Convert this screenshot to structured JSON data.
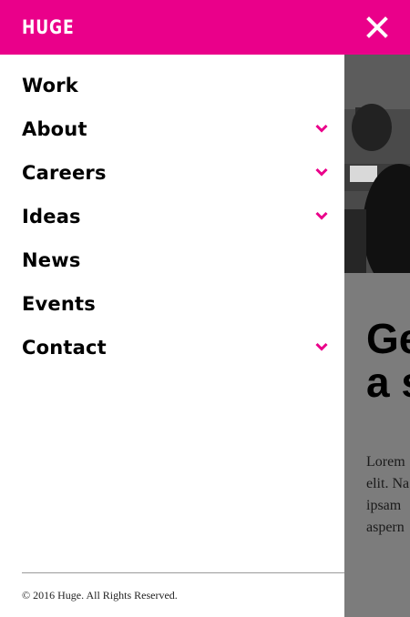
{
  "header": {
    "logo": "HUGE",
    "close_icon": "close-icon",
    "brand_color": "#ea008a"
  },
  "nav": {
    "items": [
      {
        "label": "Work",
        "has_submenu": false
      },
      {
        "label": "About",
        "has_submenu": true
      },
      {
        "label": "Careers",
        "has_submenu": true
      },
      {
        "label": "Ideas",
        "has_submenu": true
      },
      {
        "label": "News",
        "has_submenu": false
      },
      {
        "label": "Events",
        "has_submenu": false
      },
      {
        "label": "Contact",
        "has_submenu": true
      }
    ],
    "chevron_icon": "chevron-down-icon",
    "chevron_color": "#ea008a"
  },
  "footer": {
    "copyright": "© 2016 Huge. All Rights Reserved."
  },
  "background_page": {
    "heading": "Ge\na s",
    "body": "Lorem\nelit. Na\nipsam\naspern"
  }
}
